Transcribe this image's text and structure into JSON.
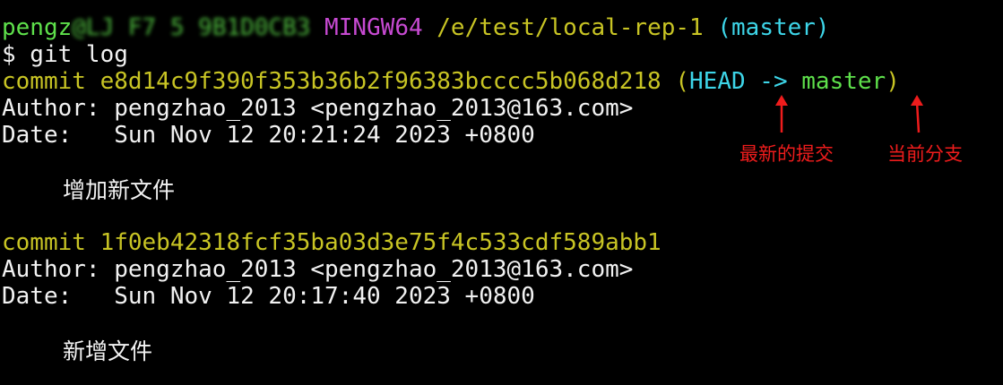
{
  "prompt": {
    "user_host_visible": "pengz",
    "user_host_redacted": "@LJ F7 5 9B1D0CB3",
    "system": "MINGW64",
    "path": "/e/test/local-rep-1",
    "branch": "(master)"
  },
  "command": "$ git log",
  "commits": [
    {
      "commit_label": "commit e8d14c9f390f353b36b2f96383bcccc5b068d218",
      "ref_open": "(",
      "ref_head": "HEAD ->",
      "ref_branch": "master",
      "ref_close": ")",
      "author": "Author: pengzhao_2013 <pengzhao_2013@163.com>",
      "date": "Date:   Sun Nov 12 20:21:24 2023 +0800",
      "message": "增加新文件"
    },
    {
      "commit_label": "commit 1f0eb42318fcf35ba03d3e75f4c533cdf589abb1",
      "author": "Author: pengzhao_2013 <pengzhao_2013@163.com>",
      "date": "Date:   Sun Nov 12 20:17:40 2023 +0800",
      "message": "新增文件"
    }
  ],
  "annotations": {
    "latest_commit": "最新的提交",
    "current_branch": "当前分支",
    "color": "#ee1c1c"
  },
  "colors": {
    "background": "#000000",
    "prompt_user": "#5ee04b",
    "prompt_system": "#c74ad2",
    "prompt_path": "#c8c424",
    "prompt_branch": "#3dd5e8",
    "commit_hash": "#c8c424",
    "head_ref": "#3dd5e8",
    "branch_ref": "#5ee04b",
    "text": "#f2f2f2"
  }
}
